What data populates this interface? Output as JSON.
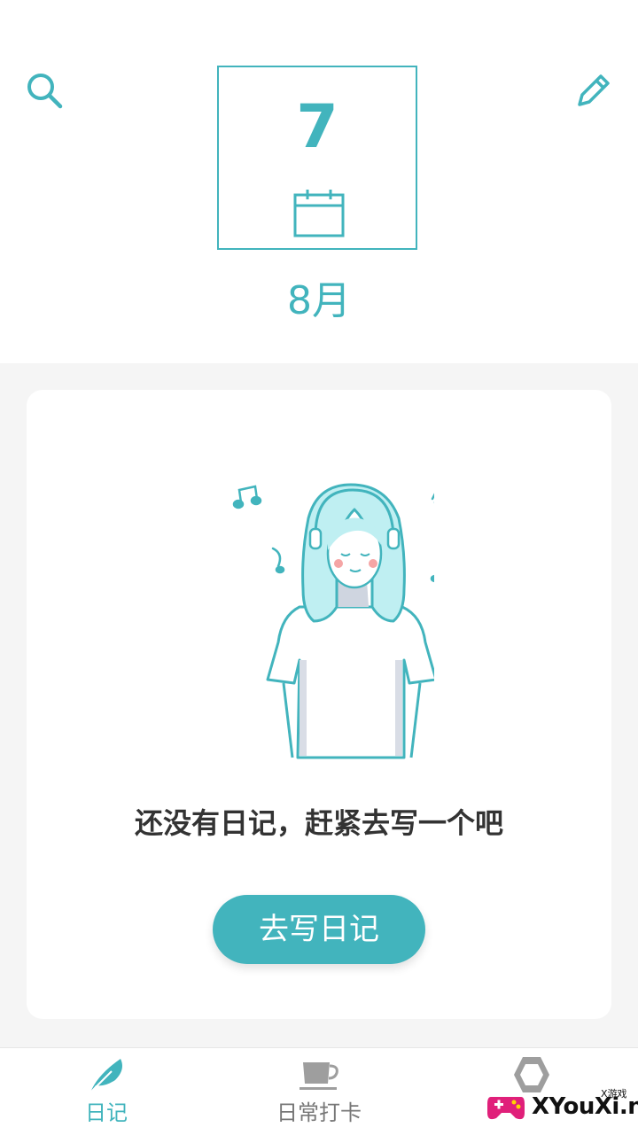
{
  "header": {
    "day": "7",
    "month": "8月",
    "search_icon": "search-icon",
    "edit_icon": "pencil-icon",
    "calendar_icon": "calendar-icon"
  },
  "empty_state": {
    "illustration": "girl-with-headphones-illustration",
    "message": "还没有日记，赶紧去写一个吧",
    "button_label": "去写日记"
  },
  "bottom_nav": {
    "items": [
      {
        "label": "日记",
        "icon": "feather-icon",
        "active": true
      },
      {
        "label": "日常打卡",
        "icon": "cup-icon",
        "active": false
      },
      {
        "label": "",
        "icon": "hexagon-icon",
        "active": false
      }
    ]
  },
  "watermark": {
    "text": "XYouXi.net",
    "small_text": "X游戏"
  },
  "colors": {
    "accent": "#42b4bd",
    "text_dark": "#333333",
    "inactive": "#9e9e9e",
    "background": "#f5f5f5"
  }
}
